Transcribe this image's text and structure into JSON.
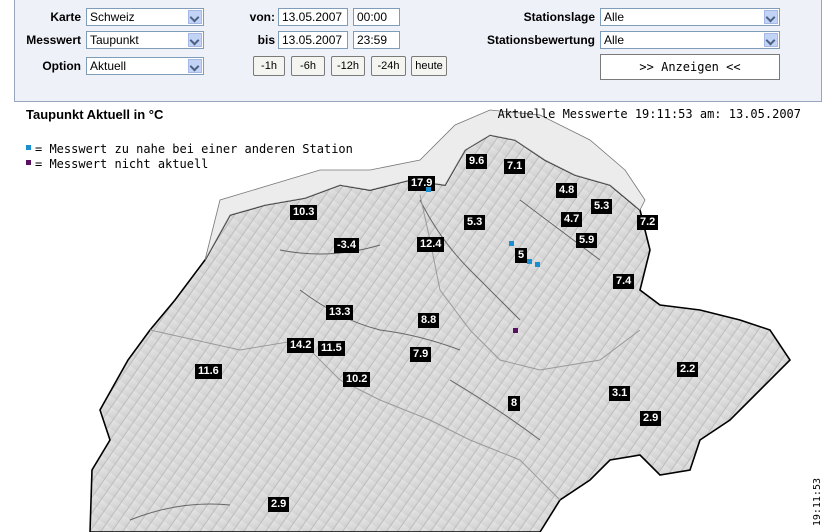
{
  "controls": {
    "karte_label": "Karte",
    "karte_value": "Schweiz",
    "messwert_label": "Messwert",
    "messwert_value": "Taupunkt",
    "option_label": "Option",
    "option_value": "Aktuell",
    "von_label": "von:",
    "von_date": "13.05.2007",
    "von_time": "00:00",
    "bis_label": "bis",
    "bis_date": "13.05.2007",
    "bis_time": "23:59",
    "quick_buttons": [
      "-1h",
      "-6h",
      "-12h",
      "-24h",
      "heute"
    ],
    "stationslage_label": "Stationslage",
    "stationslage_value": "Alle",
    "stationsbewertung_label": "Stationsbewertung",
    "stationsbewertung_value": "Alle",
    "show_button": ">> Anzeigen <<"
  },
  "title": "Taupunkt Aktuell in °C",
  "meta": "Aktuelle Messwerte 19:11:53 am: 13.05.2007",
  "legend": {
    "near": "= Messwert zu nahe bei einer anderen Station",
    "near_color": "#1a8fd0",
    "stale": "= Messwert nicht aktuell",
    "stale_color": "#5a1060"
  },
  "stations": [
    {
      "v": "9.6"
    },
    {
      "v": "7.1"
    },
    {
      "v": "17.9"
    },
    {
      "v": "4.8"
    },
    {
      "v": "5.3"
    },
    {
      "v": "10.3"
    },
    {
      "v": "5.3"
    },
    {
      "v": "4.7"
    },
    {
      "v": "7.2"
    },
    {
      "v": "-3.4"
    },
    {
      "v": "12.4"
    },
    {
      "v": "5.9"
    },
    {
      "v": "5"
    },
    {
      "v": "7.4"
    },
    {
      "v": "13.3"
    },
    {
      "v": "8.8"
    },
    {
      "v": "14.2"
    },
    {
      "v": "11.5"
    },
    {
      "v": "7.9"
    },
    {
      "v": "11.6"
    },
    {
      "v": "10.2"
    },
    {
      "v": "2.2"
    },
    {
      "v": "3.1"
    },
    {
      "v": "8"
    },
    {
      "v": "2.9"
    },
    {
      "v": "2.9"
    }
  ],
  "timestamp_side": "19:11:53"
}
